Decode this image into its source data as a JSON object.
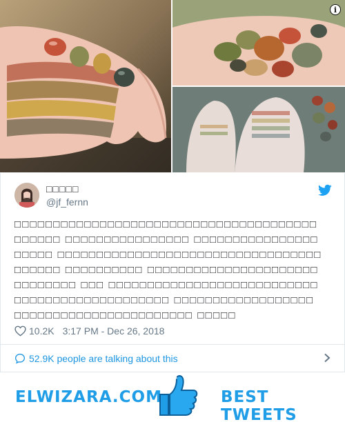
{
  "photos": {
    "info_icon": "info-icon",
    "info_glyph": "i"
  },
  "tweet": {
    "display_name": "□□□□□",
    "handle": "@jf_fernn",
    "text": "□□□□□□□□□□□□□□□□□□□□□□□□□□□□□□□□□□□□□□□□□□□□□ □□□□□□□□□□□□□□□□ □□□□□□□□□□□□□□□□ □□□□□ □□□□□□□□□□□□□□□□□□□□□□□□□□□□□□□□□□□□□□□□ □□□□□□□□□□ □□□□□□□□□□□□□□□□□□□□□□□□□□□□□□ □□□ □□□□□□□□□□□□□□□□□□□□□□□□□□□□□□□□□□□□□□□□□□□□□□□ □□□□□□□□□□□□□□□□□□ □□□□□□□□□□□□□□□□□□□□□□□ □□□□□",
    "likes": "10.2K",
    "timestamp": "3:17 PM - Dec 26, 2018",
    "conversation": "52.9K people are talking about this"
  },
  "banner": {
    "site": "ELWIZARA.COM",
    "tagline": "BEST TWEETS"
  },
  "colors": {
    "accent": "#1b95e0",
    "banner_blue": "#1f9de6",
    "muted": "#657786",
    "border": "#e1e8ed"
  }
}
